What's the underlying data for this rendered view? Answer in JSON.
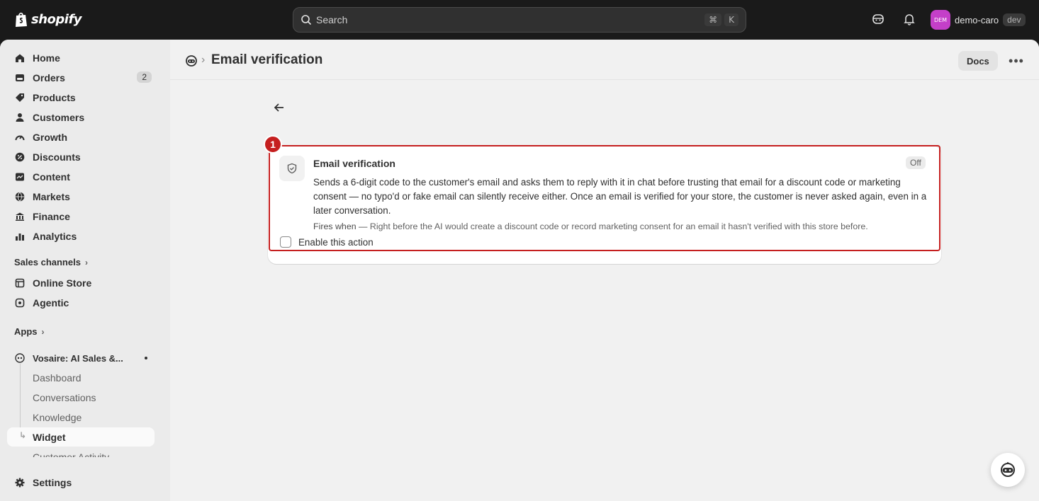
{
  "topbar": {
    "brand": "shopify",
    "search_placeholder": "Search",
    "shortcut_cmd": "⌘",
    "shortcut_key": "K",
    "account_initials": "DEM",
    "account_name": "demo-caro",
    "account_badge": "dev"
  },
  "sidebar": {
    "items": [
      {
        "label": "Home",
        "icon": "home-icon"
      },
      {
        "label": "Orders",
        "icon": "orders-icon",
        "count": "2"
      },
      {
        "label": "Products",
        "icon": "tag-icon"
      },
      {
        "label": "Customers",
        "icon": "person-icon"
      },
      {
        "label": "Growth",
        "icon": "gauge-icon"
      },
      {
        "label": "Discounts",
        "icon": "discount-icon"
      },
      {
        "label": "Content",
        "icon": "content-icon"
      },
      {
        "label": "Markets",
        "icon": "globe-icon"
      },
      {
        "label": "Finance",
        "icon": "bank-icon"
      },
      {
        "label": "Analytics",
        "icon": "chart-bar-icon"
      }
    ],
    "sales_channels_label": "Sales channels",
    "channels": [
      {
        "label": "Online Store",
        "icon": "store-icon"
      },
      {
        "label": "Agentic",
        "icon": "agentic-icon"
      }
    ],
    "apps_label": "Apps",
    "app_name": "Vosaire: AI Sales &...",
    "app_sub": [
      "Dashboard",
      "Conversations",
      "Knowledge",
      "Widget",
      "Customer Activity"
    ],
    "settings_label": "Settings"
  },
  "header": {
    "title": "Email verification",
    "docs_label": "Docs",
    "more_label": "•••"
  },
  "action": {
    "marker": "1",
    "title": "Email verification",
    "status": "Off",
    "description": "Sends a 6-digit code to the customer's email and asks them to reply with it in chat before trusting that email for a discount code or marketing consent — no typo'd or fake email can silently receive either. Once an email is verified for your store, the customer is never asked again, even in a later conversation.",
    "fires_label": "Fires when —",
    "fires_text": "Right before the AI would create a discount code or record marketing consent for an email it hasn't verified with this store before.",
    "enable_label": "Enable this action"
  },
  "colors": {
    "accent_red": "#c51f1f",
    "avatar": "#c43fc9"
  }
}
